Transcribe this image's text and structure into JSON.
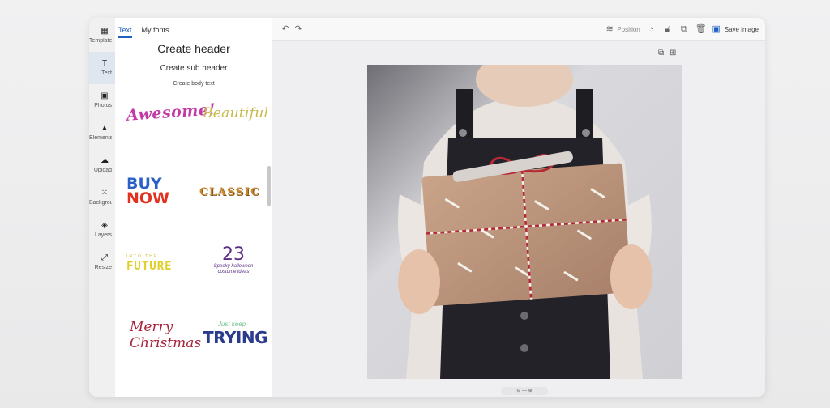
{
  "rail": {
    "items": [
      {
        "label": "Templates",
        "icon": "grid-icon"
      },
      {
        "label": "Text",
        "icon": "text-icon"
      },
      {
        "label": "Photos",
        "icon": "image-icon"
      },
      {
        "label": "Elements",
        "icon": "shapes-icon"
      },
      {
        "label": "Upload",
        "icon": "upload-icon"
      },
      {
        "label": "Background",
        "icon": "pattern-icon"
      },
      {
        "label": "Layers",
        "icon": "layers-icon"
      },
      {
        "label": "Resize",
        "icon": "resize-icon"
      }
    ]
  },
  "panel": {
    "tabs": [
      {
        "label": "Text"
      },
      {
        "label": "My fonts"
      }
    ],
    "create_header": "Create header",
    "create_sub_header": "Create sub header",
    "create_body_text": "Create body text",
    "presets": {
      "awesome": "Awesome!",
      "beautiful": "Beautiful",
      "buy": "BUY",
      "now": "NOW",
      "classic": "CLASSIC",
      "future_small": "INTO THE",
      "future_big": "FUTURE",
      "num": "23",
      "num_sub": "Spooky halloween costume ideas",
      "merry": "Merry",
      "christmas": "Christmas",
      "trying_small": "Just keep",
      "trying_big": "TRYING"
    }
  },
  "toolbar": {
    "undo_icon": "undo-icon",
    "redo_icon": "redo-icon",
    "position_label": "Position",
    "save_label": "Save image"
  },
  "colors": {
    "accent": "#1f5fbf",
    "rail_active": "#dfe6ef"
  }
}
